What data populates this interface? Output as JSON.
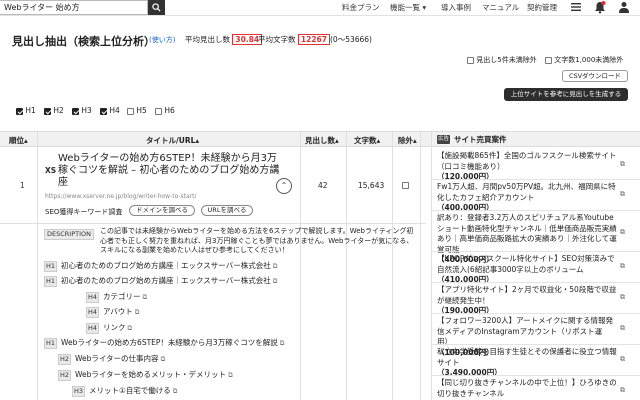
{
  "topbar": {
    "search_value": "Webライター 始め方",
    "nav": [
      "料金プラン",
      "機能一覧 ▾",
      "導入事例",
      "マニュアル",
      "契約管理"
    ],
    "icons": [
      "search-icon",
      "menu-icon",
      "bell-icon",
      "user-icon"
    ]
  },
  "header": {
    "title": "見出し抽出（検索上位分析）",
    "how_to": "(使い方)",
    "avg_heading_label": "平均見出し数",
    "avg_heading_value": "30.84",
    "avg_chars_label": "平均文字数",
    "avg_chars_value": "12267",
    "range": "(0〜53666)",
    "exclude5": "見出し5件未満除外",
    "exclude1000": "文字数1,000未満除外",
    "csv": "CSVダウンロード",
    "generate": "上位サイトを参考に見出しを生成する"
  },
  "filters": [
    {
      "label": "H1",
      "checked": true
    },
    {
      "label": "H2",
      "checked": true
    },
    {
      "label": "H3",
      "checked": true
    },
    {
      "label": "H4",
      "checked": true
    },
    {
      "label": "H5",
      "checked": false
    },
    {
      "label": "H6",
      "checked": false
    }
  ],
  "table": {
    "col_rank": "順位",
    "col_title": "タイトル/URL",
    "col_headings": "見出し数",
    "col_chars": "文字数",
    "col_exclude": "除外",
    "ad_tag": "広告",
    "col_cases": "サイト売買案件"
  },
  "row": {
    "rank": "1",
    "logo": "XS",
    "title": "Webライターの始め方6STEP！未経験から月3万稼ぐコツを解説 – 初心者のためのブログ始め方講座",
    "url": "https://www.xserver.ne.jp/blog/writer-how-to-start/",
    "seo_label": "SEO獲得キーワード調査",
    "domain_btn": "ドメインを調べる",
    "url_btn": "URLを調べる",
    "headings": "42",
    "chars": "15,643",
    "desc_tag": "DESCRIPTION",
    "description": "この記事では未経験からWebライターを始める方法を6ステップで解説します。Webライティング初心者でも正しく努力を重ねれば、月3万円稼ぐことも夢ではありません。Webライターが気になる、スキルになる副業を始めたい人はぜひ参考にしてください！"
  },
  "heading_list": [
    {
      "tag": "H1",
      "text": "初心者のためのブログ始め方講座｜エックスサーバー株式会社"
    },
    {
      "tag": "H1",
      "text": "初心者のためのブログ始め方講座｜エックスサーバー株式会社"
    },
    {
      "tag": "H4",
      "text": "カテゴリー"
    },
    {
      "tag": "H4",
      "text": "アバウト"
    },
    {
      "tag": "H4",
      "text": "リンク"
    },
    {
      "tag": "H1",
      "text": "Webライターの始め方6STEP！未経験から月3万稼ぐコツを解説"
    },
    {
      "tag": "H2",
      "text": "Webライターの仕事内容"
    },
    {
      "tag": "H2",
      "text": "Webライターを始めるメリット・デメリット"
    },
    {
      "tag": "H3",
      "text": "メリット①自宅で働ける"
    }
  ],
  "cases": [
    {
      "text": "【施設掲載865件】全国のゴルフスクール検索サイト（口コミ機能あり）",
      "price": "（120,000円）"
    },
    {
      "text": "Fw1万人超、月間pv50万PV超。北九州、福岡県に特化したカフェ紹介アカウント",
      "price": "（400,000円）"
    },
    {
      "text": "訳あり：登録者3.2万人のスピリチュアル系Youtubeショート動画特化型チャンネル｜低単価商品販売実績あり｜高単価商品販路拡大の実績あり｜外注化して運営可能",
      "price": "（400,000円）"
    },
    {
      "text": "【KPOPダンススクール特化サイト】SEO対策済みで自然流入(6紹記事3000字以上のボリューム",
      "price": "（410,000円）"
    },
    {
      "text": "【アプリ特化サイト】2ヶ月で収益化・50段階で収益が継続発生中！",
      "price": "（190,000円）"
    },
    {
      "text": "【フォロワー3200人】アートメイクに関する情報発信メディアのInstagramアカウント（リポスト運用）",
      "price": "（100,000円）"
    },
    {
      "text": "私立中学受験を目指す生徒とその保護者に役立つ情報サイト",
      "price": "（3,490,000円）"
    },
    {
      "text": "【同じ切り抜きチャンネルの中で上位！】ひろゆきの切り抜きチャンネル",
      "price": ""
    }
  ]
}
